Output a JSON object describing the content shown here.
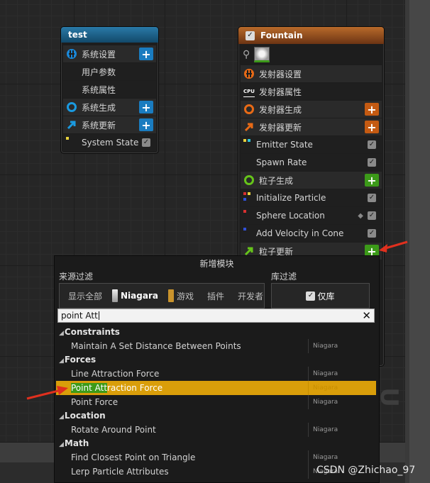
{
  "nodes": {
    "system": {
      "title": "test",
      "rows": [
        {
          "label": "系统设置",
          "icon": "system-settings-icon"
        },
        {
          "label": "用户参数"
        },
        {
          "label": "系统属性"
        },
        {
          "label": "系统生成",
          "icon": "spawn-ring-icon"
        },
        {
          "label": "系统更新",
          "icon": "update-arrow-icon"
        },
        {
          "label": "System State"
        }
      ]
    },
    "emitter": {
      "title": "Fountain",
      "rows": [
        {
          "label": "发射器设置",
          "icon": "emitter-settings-icon"
        },
        {
          "label": "发射器属性",
          "icon": "cpu-icon",
          "icon_text": "CPU"
        },
        {
          "label": "发射器生成",
          "icon": "spawn-ring-icon"
        },
        {
          "label": "发射器更新",
          "icon": "update-arrow-icon"
        },
        {
          "label": "Emitter State"
        },
        {
          "label": "Spawn Rate"
        },
        {
          "label": "粒子生成",
          "icon": "spawn-ring-icon"
        },
        {
          "label": "Initialize Particle"
        },
        {
          "label": "Sphere Location"
        },
        {
          "label": "Add Velocity in Cone"
        },
        {
          "label": "粒子更新",
          "icon": "update-arrow-icon"
        }
      ]
    }
  },
  "dialog": {
    "title": "新增模块",
    "source_filter_label": "来源过滤",
    "library_filter_label": "库过滤",
    "source_filters": [
      "显示全部",
      "Niagara",
      "游戏",
      "插件",
      "开发者"
    ],
    "library_only": "仅库",
    "search": {
      "value": "point Att",
      "clear_icon": "close-icon"
    },
    "categories": [
      {
        "name": "Constraints",
        "items": [
          {
            "name": "Maintain A Set Distance Between Points",
            "source": "Niagara"
          }
        ]
      },
      {
        "name": "Forces",
        "items": [
          {
            "name": "Line Attraction Force",
            "source": "Niagara"
          },
          {
            "name": "Point Attraction Force",
            "source": "Niagara",
            "selected": true,
            "match": "Point Att",
            "rest": "raction Force"
          },
          {
            "name": "Point Force",
            "source": "Niagara"
          }
        ]
      },
      {
        "name": "Location",
        "items": [
          {
            "name": "Rotate Around Point",
            "source": "Niagara"
          }
        ]
      },
      {
        "name": "Math",
        "items": [
          {
            "name": "Find Closest Point on Triangle",
            "source": "Niagara"
          },
          {
            "name": "Lerp Particle Attributes",
            "source": "Niagara"
          }
        ]
      }
    ]
  },
  "watermark": "CSDN @Zhichao_97",
  "colors": {
    "selection": "#d99e0a",
    "match_highlight": "#3c9a19",
    "system_header": "#1b5f86",
    "emitter_header": "#a4551d",
    "arrow": "#e0301e"
  }
}
